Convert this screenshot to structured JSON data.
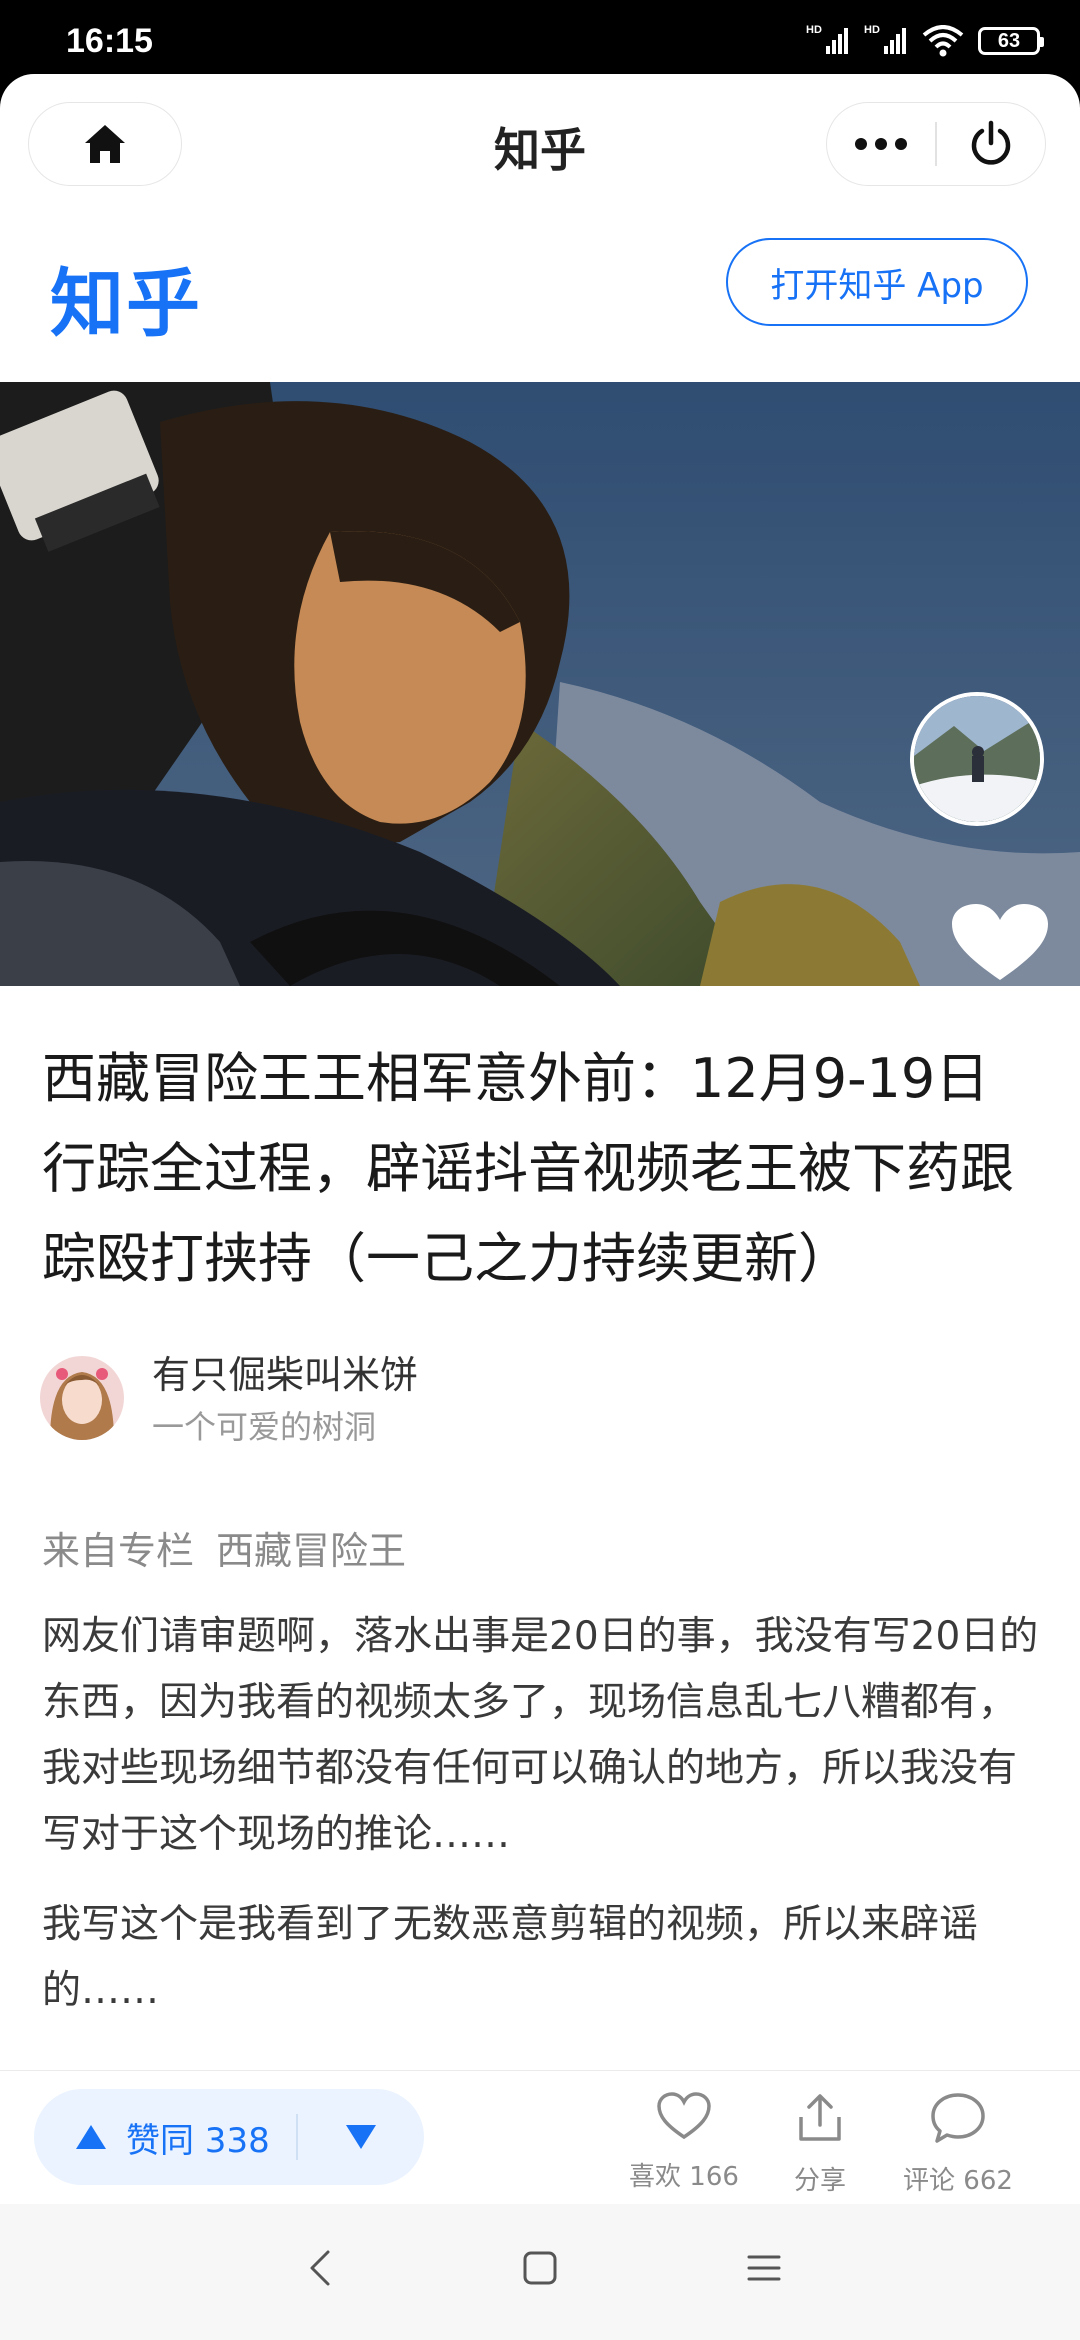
{
  "status_bar": {
    "time": "16:15",
    "network_1": "HD",
    "network_2": "HD",
    "battery": "63"
  },
  "mini_program": {
    "title": "知乎",
    "home_icon": "home-icon",
    "more_icon": "more-icon",
    "close_icon": "power-icon"
  },
  "header": {
    "logo": "知乎",
    "open_app_label": "打开知乎 App"
  },
  "article": {
    "title": "西藏冒险王王相军意外前：12月9-19日行踪全过程，辟谣抖音视频老王被下药跟踪殴打挟持（一己之力持续更新）",
    "author": {
      "name": "有只倔柴叫米饼",
      "bio": "一个可爱的树洞"
    },
    "column_prefix": "来自专栏",
    "column_name": "西藏冒险王",
    "paragraphs": [
      "网友们请审题啊，落水出事是20日的事，我没有写20日的东西，因为我看的视频太多了，现场信息乱七八糟都有，我对些现场细节都没有任何可以确认的地方，所以我没有写对于这个现场的推论……",
      "我写这个是我看到了无数恶意剪辑的视频，所以来辟谣的……"
    ]
  },
  "actions": {
    "upvote_label": "赞同 338",
    "like_label": "喜欢 166",
    "share_label": "分享",
    "comment_label": "评论 662"
  },
  "colors": {
    "brand": "#1772f6",
    "upvote_bg": "#eaf3ff"
  }
}
